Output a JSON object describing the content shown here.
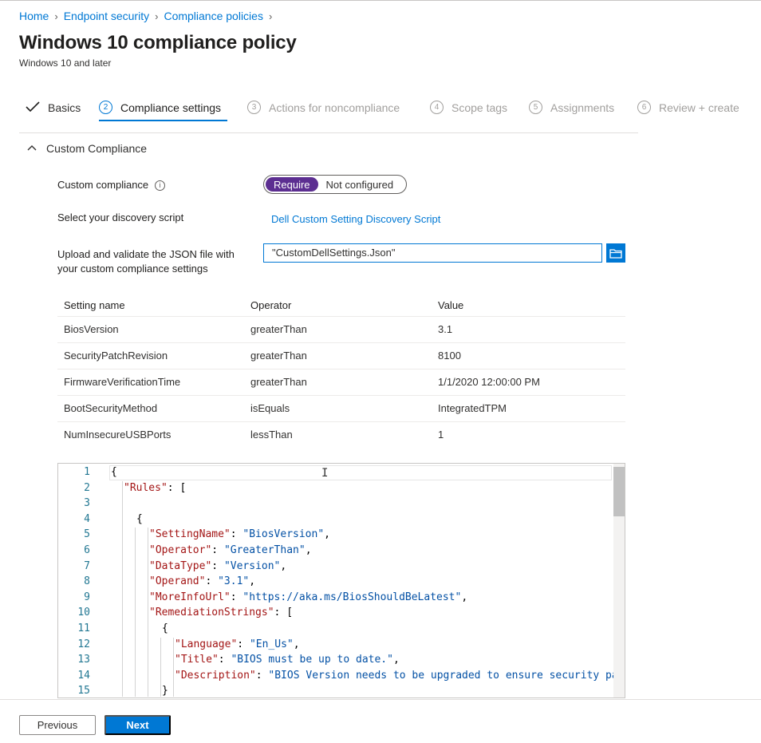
{
  "breadcrumb": [
    "Home",
    "Endpoint security",
    "Compliance policies"
  ],
  "page": {
    "title": "Windows 10 compliance policy",
    "subtitle": "Windows 10 and later"
  },
  "wizard": {
    "steps": [
      {
        "num": "",
        "label": "Basics",
        "state": "done"
      },
      {
        "num": "2",
        "label": "Compliance settings",
        "state": "active"
      },
      {
        "num": "3",
        "label": "Actions for noncompliance",
        "state": "pending"
      },
      {
        "num": "4",
        "label": "Scope tags",
        "state": "pending"
      },
      {
        "num": "5",
        "label": "Assignments",
        "state": "pending"
      },
      {
        "num": "6",
        "label": "Review + create",
        "state": "pending"
      }
    ]
  },
  "section": {
    "title": "Custom Compliance"
  },
  "form": {
    "custom_compliance_label": "Custom compliance",
    "toggle_on": "Require",
    "toggle_off": "Not configured",
    "discovery_label": "Select your discovery script",
    "discovery_link": "Dell Custom Setting Discovery Script",
    "upload_label_1": "Upload and validate the JSON file with",
    "upload_label_2": "your custom compliance settings",
    "json_value": "\"CustomDellSettings.Json\""
  },
  "table": {
    "headers": [
      "Setting name",
      "Operator",
      "Value"
    ],
    "rows": [
      [
        "BiosVersion",
        "greaterThan",
        "3.1"
      ],
      [
        "SecurityPatchRevision",
        "greaterThan",
        "8100"
      ],
      [
        "FirmwareVerificationTime",
        "greaterThan",
        "1/1/2020 12:00:00 PM"
      ],
      [
        "BootSecurityMethod",
        "isEquals",
        "IntegratedTPM"
      ],
      [
        "NumInsecureUSBPorts",
        "lessThan",
        "1"
      ]
    ]
  },
  "editor": {
    "lines": [
      {
        "n": "1",
        "indent": 0,
        "parts": [
          [
            "p",
            "{"
          ]
        ]
      },
      {
        "n": "2",
        "indent": 1,
        "parts": [
          [
            "k",
            "\"Rules\""
          ],
          [
            "p",
            ": ["
          ]
        ]
      },
      {
        "n": "3",
        "indent": 0,
        "parts": []
      },
      {
        "n": "4",
        "indent": 2,
        "parts": [
          [
            "p",
            "{"
          ]
        ]
      },
      {
        "n": "5",
        "indent": 3,
        "parts": [
          [
            "k",
            "\"SettingName\""
          ],
          [
            "p",
            ": "
          ],
          [
            "v",
            "\"BiosVersion\""
          ],
          [
            "p",
            ","
          ]
        ]
      },
      {
        "n": "6",
        "indent": 3,
        "parts": [
          [
            "k",
            "\"Operator\""
          ],
          [
            "p",
            ": "
          ],
          [
            "v",
            "\"GreaterThan\""
          ],
          [
            "p",
            ","
          ]
        ]
      },
      {
        "n": "7",
        "indent": 3,
        "parts": [
          [
            "k",
            "\"DataType\""
          ],
          [
            "p",
            ": "
          ],
          [
            "v",
            "\"Version\""
          ],
          [
            "p",
            ","
          ]
        ]
      },
      {
        "n": "8",
        "indent": 3,
        "parts": [
          [
            "k",
            "\"Operand\""
          ],
          [
            "p",
            ": "
          ],
          [
            "v",
            "\"3.1\""
          ],
          [
            "p",
            ","
          ]
        ]
      },
      {
        "n": "9",
        "indent": 3,
        "parts": [
          [
            "k",
            "\"MoreInfoUrl\""
          ],
          [
            "p",
            ": "
          ],
          [
            "v",
            "\"https://aka.ms/BiosShouldBeLatest\""
          ],
          [
            "p",
            ","
          ]
        ]
      },
      {
        "n": "10",
        "indent": 3,
        "parts": [
          [
            "k",
            "\"RemediationStrings\""
          ],
          [
            "p",
            ": ["
          ]
        ]
      },
      {
        "n": "11",
        "indent": 4,
        "parts": [
          [
            "p",
            "{"
          ]
        ]
      },
      {
        "n": "12",
        "indent": 5,
        "parts": [
          [
            "k",
            "\"Language\""
          ],
          [
            "p",
            ": "
          ],
          [
            "v",
            "\"En_Us\""
          ],
          [
            "p",
            ","
          ]
        ]
      },
      {
        "n": "13",
        "indent": 5,
        "parts": [
          [
            "k",
            "\"Title\""
          ],
          [
            "p",
            ": "
          ],
          [
            "v",
            "\"BIOS must be up to date.\""
          ],
          [
            "p",
            ","
          ]
        ]
      },
      {
        "n": "14",
        "indent": 5,
        "parts": [
          [
            "k",
            "\"Description\""
          ],
          [
            "p",
            ": "
          ],
          [
            "v",
            "\"BIOS Version needs to be upgraded to ensure security pa"
          ]
        ]
      },
      {
        "n": "15",
        "indent": 4,
        "parts": [
          [
            "p",
            "}"
          ]
        ]
      }
    ]
  },
  "footer": {
    "previous": "Previous",
    "next": "Next"
  },
  "colors": {
    "accent": "#0078d4",
    "toggle_on": "#5c2e91"
  },
  "icons": {
    "chevron": "chevron-right-icon",
    "check": "checkmark-icon",
    "info": "info-icon",
    "browse": "folder-browse-icon"
  }
}
